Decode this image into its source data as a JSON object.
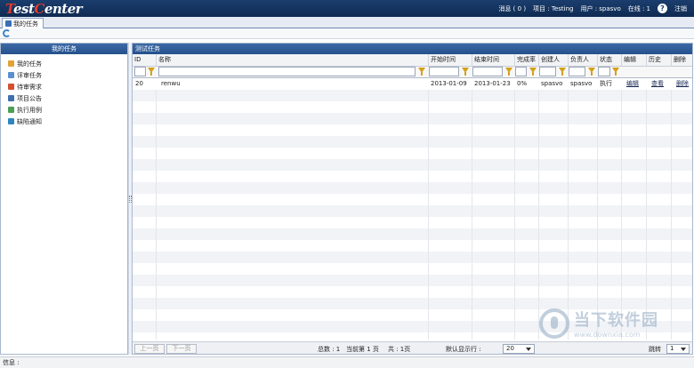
{
  "app": {
    "logo_prefix": "est",
    "logo_mid": "C",
    "logo_suffix": "enter",
    "logo_t": "T"
  },
  "topbar": {
    "messages": "消息 ( 0 )",
    "project": "项目 : Testing",
    "user": "用户 : spasvo",
    "online": "在线 : 1",
    "help_glyph": "?",
    "logout": "注销"
  },
  "tabs": [
    {
      "label": "我的任务"
    }
  ],
  "sidebar": {
    "title": "我的任务",
    "items": [
      {
        "label": "我的任务",
        "icon": "user-task-icon",
        "color": "#e2a23a"
      },
      {
        "label": "评审任务",
        "icon": "review-icon",
        "color": "#5a8fd1"
      },
      {
        "label": "待审需求",
        "icon": "pending-icon",
        "color": "#d5502f"
      },
      {
        "label": "项目公告",
        "icon": "announcement-icon",
        "color": "#3f6fb0"
      },
      {
        "label": "执行用例",
        "icon": "run-case-icon",
        "color": "#4aa055"
      },
      {
        "label": "缺陷通知",
        "icon": "bug-notify-icon",
        "color": "#2e86c1"
      }
    ]
  },
  "panel": {
    "title": "测试任务",
    "columns": [
      {
        "key": "id",
        "label": "ID"
      },
      {
        "key": "name",
        "label": "名称"
      },
      {
        "key": "start",
        "label": "开始时间"
      },
      {
        "key": "end",
        "label": "结束时间"
      },
      {
        "key": "rate",
        "label": "完成率"
      },
      {
        "key": "creator",
        "label": "创建人"
      },
      {
        "key": "owner",
        "label": "负责人"
      },
      {
        "key": "status",
        "label": "状态"
      },
      {
        "key": "edit",
        "label": "编辑"
      },
      {
        "key": "history",
        "label": "历史"
      },
      {
        "key": "delete",
        "label": "删除"
      }
    ],
    "rows": [
      {
        "id": "20",
        "name": "renwu",
        "start": "2013-01-09",
        "end": "2013-01-23",
        "rate": "0%",
        "creator": "spasvo",
        "owner": "spasvo",
        "status": "执行",
        "edit": "编辑",
        "history": "查看",
        "delete": "删除"
      }
    ]
  },
  "pager": {
    "prev": "上一页",
    "next": "下一页",
    "total": "总数 : 1",
    "current": "当前第   1 页",
    "pages": "共 : 1页",
    "per_page_label": "默认显示行 :",
    "per_page_value": "20",
    "jump_label": "跳转",
    "jump_value": "1"
  },
  "status": {
    "info": "信息 :"
  },
  "watermark": {
    "title": "当下软件园",
    "url": "www.downxia.com"
  }
}
